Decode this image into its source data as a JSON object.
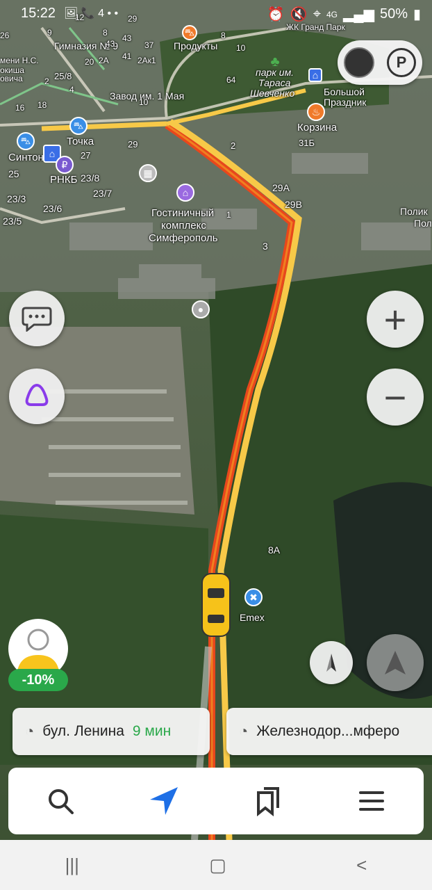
{
  "status_bar": {
    "time": "15:22",
    "left_icons": "🖼 📞 4 • •",
    "network": "4G",
    "battery": "50%"
  },
  "map": {
    "labels": {
      "gymnasium": "Гимназия № 9",
      "zavod": "Завод им. 1 Мая",
      "park": "парк им. Тараса Шевченко",
      "park_line1": "парк им.",
      "park_line2": "Тараса",
      "park_line3": "Шевченко",
      "big_holiday_1": "Большой",
      "big_holiday_2": "Праздник",
      "korzina": "Корзина",
      "tochka": "Точка",
      "sinton": "Синтон",
      "rnkb": "РНКБ",
      "produkty": "Продукты",
      "hotel_1": "Гостиничный",
      "hotel_2": "комплекс",
      "hotel_3": "Симферополь",
      "emex": "Emex",
      "zhk": "ЖК Гранд Парк",
      "polik_1": "Полик",
      "polik_2": "Пол",
      "nick_1": "мени Н.С.",
      "nick_2": "окиша",
      "nick_3": "овича"
    },
    "house_numbers": [
      "9",
      "8",
      "2",
      "43",
      "41",
      "43",
      "29",
      "37",
      "8",
      "10",
      "12",
      "64",
      "25/8",
      "20",
      "2А",
      "2Ак1",
      "18",
      "16",
      "4",
      "29",
      "27",
      "2",
      "31Б",
      "29А",
      "29В",
      "23/8",
      "23/7",
      "25",
      "23/3",
      "23/6",
      "23/5",
      "1",
      "3",
      "8А",
      "10",
      "26"
    ]
  },
  "controls": {
    "zoom_in": "+",
    "zoom_out": "−",
    "parking_label": "P",
    "discount": "-10%"
  },
  "routes": [
    {
      "name": "бул. Ленина",
      "time": "9 мин"
    },
    {
      "name": "Железнодор...мферо",
      "time": ""
    }
  ],
  "colors": {
    "route_red": "#e8471c",
    "route_orange": "#f5a623",
    "route_yellow": "#f7c948",
    "accent_blue": "#1e6fe6",
    "discount_green": "#2aa84a"
  }
}
